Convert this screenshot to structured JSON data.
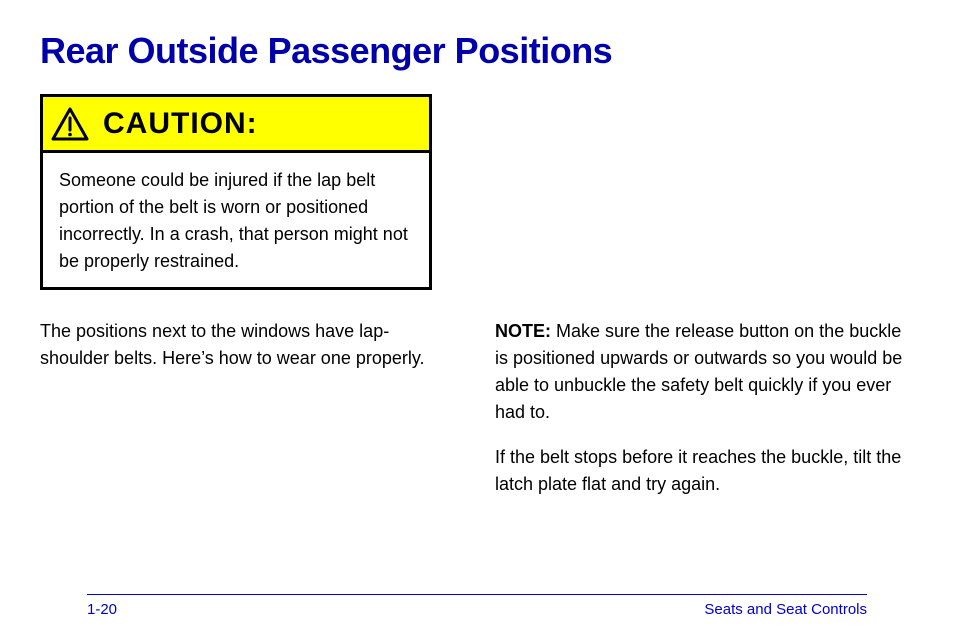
{
  "heading": "Rear Outside Passenger Positions",
  "caution": {
    "label": "CAUTION:",
    "body": "Someone could be injured if the lap belt portion of the belt is worn or positioned incorrectly. In a crash, that person might not be properly restrained."
  },
  "left_column": {
    "paragraphs": [
      "The positions next to the windows have lap-shoulder belts. Here’s how to wear one properly."
    ]
  },
  "right_column": {
    "note": "NOTE:",
    "note_text": "Make sure the release button on the buckle is positioned upwards or outwards so you would be able to unbuckle the safety belt quickly if you ever had to.",
    "paragraphs": [
      "If the belt stops before it reaches the buckle, tilt the latch plate flat and try again."
    ]
  },
  "footer": {
    "page_number": "1-20",
    "section_title": "Seats and Seat Controls"
  }
}
